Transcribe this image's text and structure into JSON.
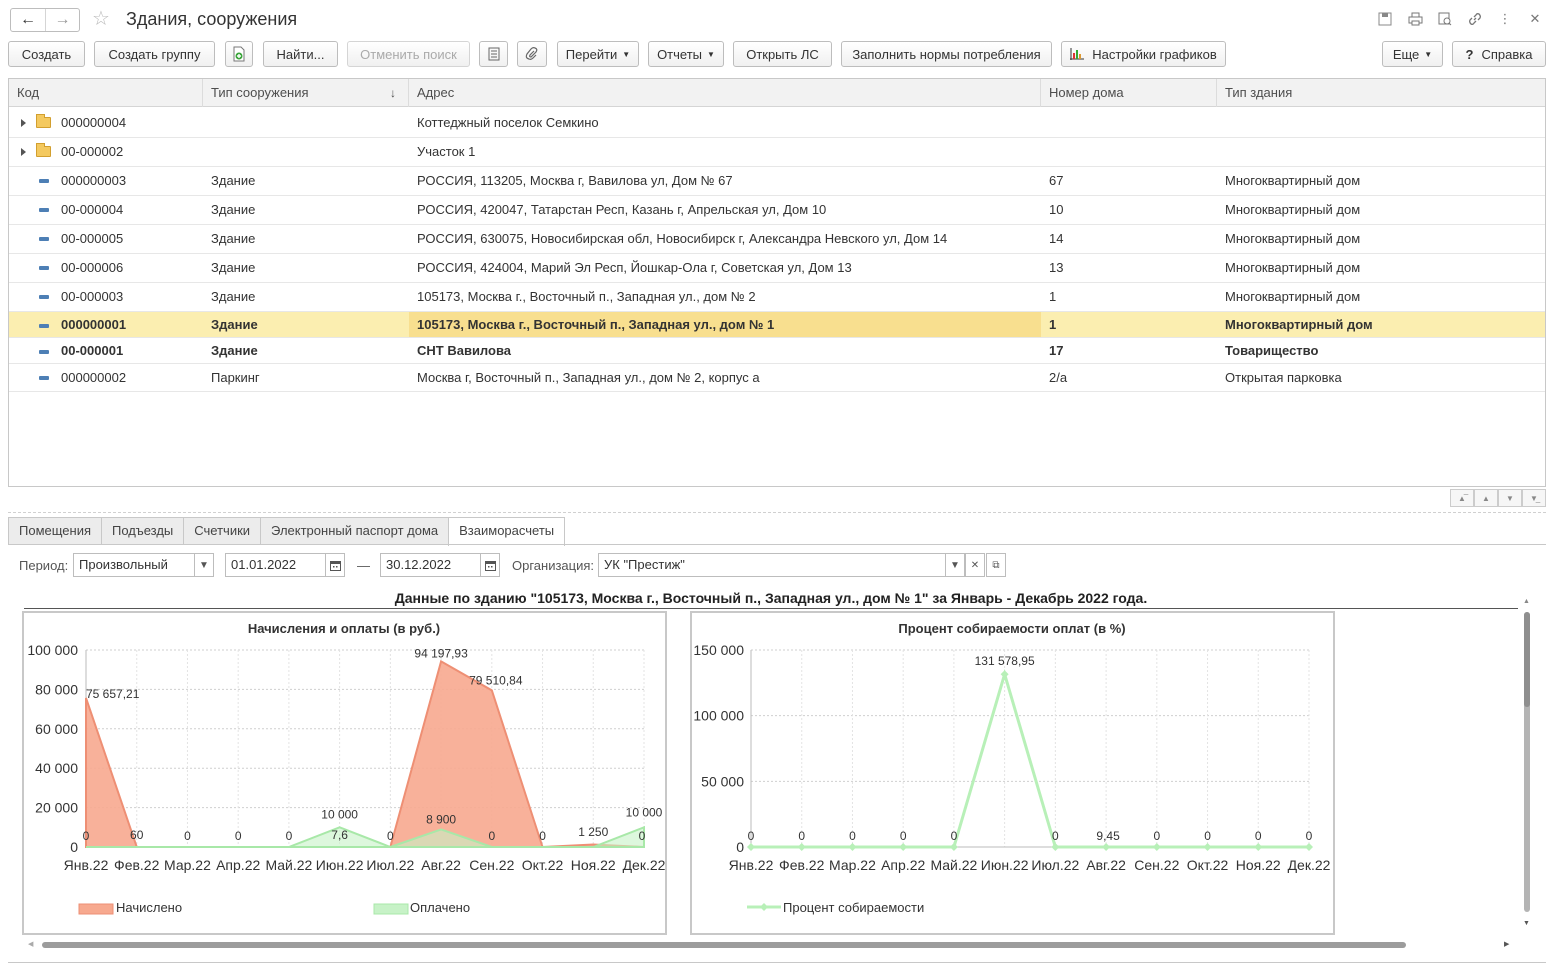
{
  "window": {
    "title": "Здания, сооружения",
    "title_icons": [
      "save-icon",
      "print-icon",
      "preview-icon",
      "link-icon",
      "more-icon",
      "close-icon"
    ]
  },
  "toolbar": {
    "create": "Создать",
    "create_group": "Создать группу",
    "find": "Найти...",
    "cancel_search": "Отменить поиск",
    "goto": "Перейти",
    "reports": "Отчеты",
    "open_ls": "Открыть ЛС",
    "fill_norms": "Заполнить нормы потребления",
    "chart_settings": "Настройки графиков",
    "more": "Еще",
    "help": "Справка",
    "help_glyph": "?"
  },
  "table": {
    "columns": [
      "Код",
      "Тип сооружения",
      "Адрес",
      "Номер дома",
      "Тип здания"
    ],
    "sort_glyph": "↓",
    "rows": [
      {
        "kind": "group",
        "code": "000000004",
        "type": "",
        "address": "Коттеджный поселок Семкино",
        "house": "",
        "building_type": ""
      },
      {
        "kind": "group",
        "code": "00-000002",
        "type": "",
        "address": "Участок 1",
        "house": "",
        "building_type": ""
      },
      {
        "kind": "item",
        "code": "000000003",
        "type": "Здание",
        "address": "РОССИЯ, 113205, Москва г, Вавилова ул, Дом № 67",
        "house": "67",
        "building_type": "Многоквартирный дом"
      },
      {
        "kind": "item",
        "code": "00-000004",
        "type": "Здание",
        "address": "РОССИЯ, 420047, Татарстан Респ, Казань г, Апрельская ул, Дом 10",
        "house": "10",
        "building_type": "Многоквартирный дом"
      },
      {
        "kind": "item",
        "code": "00-000005",
        "type": "Здание",
        "address": "РОССИЯ, 630075, Новосибирская обл, Новосибирск г, Александра Невского ул, Дом 14",
        "house": "14",
        "building_type": "Многоквартирный дом"
      },
      {
        "kind": "item",
        "code": "00-000006",
        "type": "Здание",
        "address": "РОССИЯ, 424004, Марий Эл Респ, Йошкар-Ола г, Советская ул, Дом 13",
        "house": "13",
        "building_type": "Многоквартирный дом"
      },
      {
        "kind": "item",
        "code": "00-000003",
        "type": "Здание",
        "address": "105173, Москва г., Восточный п., Западная ул., дом № 2",
        "house": "1",
        "building_type": "Многоквартирный дом"
      },
      {
        "kind": "item",
        "code": "000000001",
        "type": "Здание",
        "address": "105173, Москва г., Восточный п., Западная ул., дом № 1",
        "house": "1",
        "building_type": "Многоквартирный дом",
        "selected": true,
        "bold": true
      },
      {
        "kind": "item",
        "code": "00-000001",
        "type": "Здание",
        "address": "СНТ Вавилова",
        "house": "17",
        "building_type": "Товарищество",
        "bold": true
      },
      {
        "kind": "item",
        "code": "000000002",
        "type": "Паркинг",
        "address": "Москва г, Восточный п., Западная ул., дом № 2, корпус а",
        "house": "2/а",
        "building_type": "Открытая парковка"
      }
    ]
  },
  "tabs": [
    "Помещения",
    "Подъезды",
    "Счетчики",
    "Электронный паспорт дома",
    "Взаиморасчеты"
  ],
  "active_tab": "Взаиморасчеты",
  "filters": {
    "period_label": "Период:",
    "period_value": "Произвольный",
    "date_from": "01.01.2022",
    "dash": "—",
    "date_to": "30.12.2022",
    "org_label": "Организация:",
    "org_value": "УК \"Престиж\""
  },
  "report_title": "Данные по зданию \"105173, Москва г., Восточный п., Западная ул., дом № 1\" за Январь - Декабрь 2022 года.",
  "chart_data": [
    {
      "type": "area",
      "title": "Начисления и оплаты (в руб.)",
      "categories": [
        "Янв.22",
        "Фев.22",
        "Мар.22",
        "Апр.22",
        "Май.22",
        "Июн.22",
        "Июл.22",
        "Авг.22",
        "Сен.22",
        "Окт.22",
        "Ноя.22",
        "Дек.22"
      ],
      "ylim": [
        0,
        100000
      ],
      "yticks": [
        "0",
        "20 000",
        "40 000",
        "60 000",
        "80 000",
        "100 000"
      ],
      "grid": true,
      "legend_position": "bottom",
      "series": [
        {
          "name": "Начислено",
          "color": "#f7a98f",
          "values": [
            75657.21,
            60,
            0,
            0,
            0,
            7.6,
            0,
            94197.93,
            79510.84,
            0,
            1250,
            0
          ],
          "labels": [
            "75 657,21",
            "60",
            "0",
            "0",
            "0",
            "7,6",
            "0",
            "94 197,93",
            "79 510,84",
            "0",
            "1 250",
            "0"
          ]
        },
        {
          "name": "Оплачено",
          "color": "#c7f2c7",
          "values": [
            0,
            0,
            0,
            0,
            0,
            10000,
            0,
            8900,
            0,
            0,
            0,
            10000
          ],
          "labels": [
            "0",
            "0",
            "0",
            "0",
            "0",
            "10 000",
            "0",
            "8 900",
            "0",
            "0",
            "0",
            "10 000"
          ]
        }
      ]
    },
    {
      "type": "line",
      "title": "Процент собираемости оплат (в %)",
      "categories": [
        "Янв.22",
        "Фев.22",
        "Мар.22",
        "Апр.22",
        "Май.22",
        "Июн.22",
        "Июл.22",
        "Авг.22",
        "Сен.22",
        "Окт.22",
        "Ноя.22",
        "Дек.22"
      ],
      "ylim": [
        0,
        150000
      ],
      "yticks": [
        "0",
        "50 000",
        "100 000",
        "150 000"
      ],
      "grid": true,
      "legend_position": "bottom",
      "series": [
        {
          "name": "Процент собираемости",
          "color": "#b8f0b8",
          "values": [
            0,
            0,
            0,
            0,
            0,
            131578.95,
            0,
            9.45,
            0,
            0,
            0,
            0
          ],
          "labels": [
            "0",
            "0",
            "0",
            "0",
            "0",
            "131 578,95",
            "0",
            "9,45",
            "0",
            "0",
            "0",
            "0"
          ]
        }
      ]
    }
  ]
}
